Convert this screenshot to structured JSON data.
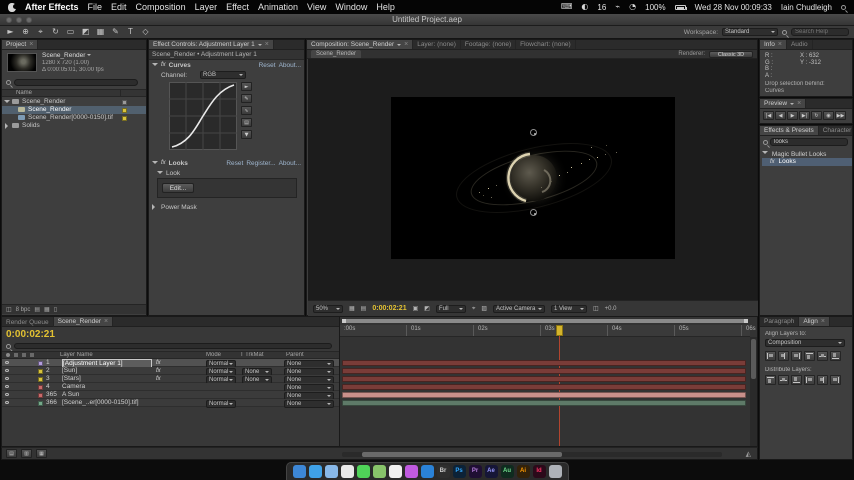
{
  "menubar": {
    "app_name": "After Effects",
    "menus": [
      "File",
      "Edit",
      "Composition",
      "Layer",
      "Effect",
      "Animation",
      "View",
      "Window",
      "Help"
    ],
    "status_count": "16",
    "battery_percent": "100%",
    "clock": "Wed 28 Nov 00:09:33",
    "user": "Iain Chudleigh"
  },
  "window": {
    "title": "Untitled Project.aep",
    "workspace_label": "Workspace:",
    "workspace_value": "Standard",
    "help_search": "Search Help"
  },
  "project": {
    "tab": "Project",
    "item_name": "Scene_Render",
    "item_meta1": "1280 x 720 (1.00)",
    "item_meta2": "Δ 0:00:05:01, 30.00 fps",
    "col_name": "Name",
    "depth": "8 bpc",
    "items": [
      {
        "label": "Scene_Render",
        "chip": "#9a9a9a"
      },
      {
        "label": "Scene_Render",
        "chip": "#d8c33c"
      },
      {
        "label": "Scene_Render[0000-0150].tif",
        "chip": "#d8c33c"
      },
      {
        "label": "Solids",
        "chip": "#9a9a9a"
      }
    ]
  },
  "effect_controls": {
    "tab": "Effect Controls: Adjustment Layer 1",
    "target": "Scene_Render • Adjustment Layer 1",
    "fx1_name": "Curves",
    "fx1_reset": "Reset",
    "fx1_about": "About...",
    "channel_label": "Channel:",
    "channel_value": "RGB",
    "fx2_name": "Looks",
    "fx2_reset": "Reset",
    "fx2_register": "Register...",
    "fx2_about": "About...",
    "look_label": "Look",
    "edit_button": "Edit...",
    "power_mask": "Power Mask"
  },
  "composition": {
    "tab": "Composition: Scene_Render",
    "tab_layer": "Layer: (none)",
    "tab_footage": "Footage: (none)",
    "tab_flowchart": "Flowchart: (none)",
    "view_tab": "Scene_Render",
    "renderer_label": "Renderer:",
    "renderer_value": "Classic 3D",
    "zoom": "50%",
    "timecode": "0:00:02:21",
    "resolution": "Full",
    "camera": "Active Camera",
    "views": "1 View",
    "exposure": "+0.0"
  },
  "info": {
    "tab": "Info",
    "tab_audio": "Audio",
    "r": "R :",
    "g": "G :",
    "b": "B :",
    "a": "A :",
    "x": "X :  632",
    "y": "Y : -312",
    "drop1": "Drop selection behind:",
    "drop2": "Curves"
  },
  "preview": {
    "tab": "Preview"
  },
  "effects_presets": {
    "tab": "Effects & Presets",
    "tab2": "Character",
    "search_value": "looks",
    "group": "Magic Bullet Looks",
    "item": "Looks"
  },
  "timeline": {
    "tab_queue": "Render Queue",
    "tab_comp": "Scene_Render",
    "timecode": "0:00:02:21",
    "col_layer": "Layer Name",
    "col_mode": "Mode",
    "col_trkmat": "T TrkMat",
    "col_parent": "Parent",
    "ruler": [
      ":00s",
      "01s",
      "02s",
      "03s",
      "04s",
      "05s",
      "06s"
    ],
    "layers": [
      {
        "num": "1",
        "name": "[Adjustment Layer 1]",
        "mode": "Normal",
        "trkmat": "",
        "parent": "None",
        "chip": "#b39ddb",
        "bar": "#7a3c38",
        "selected": true
      },
      {
        "num": "2",
        "name": "[Sun]",
        "mode": "Normal",
        "trkmat": "None",
        "parent": "None",
        "chip": "#d8c33c",
        "bar": "#7a3c38"
      },
      {
        "num": "3",
        "name": "[Stars]",
        "mode": "Normal",
        "trkmat": "None",
        "parent": "None",
        "chip": "#d8c33c",
        "bar": "#7a3c38"
      },
      {
        "num": "4",
        "name": "Camera",
        "mode": "",
        "trkmat": "",
        "parent": "None",
        "chip": "#c96a6a",
        "bar": "#7a3c38"
      },
      {
        "num": "365",
        "name": "A Sun",
        "mode": "",
        "trkmat": "",
        "parent": "None",
        "chip": "#c96a6a",
        "bar": "#c9908b"
      },
      {
        "num": "366",
        "name": "[Scene_..er[0000-0150].tif]",
        "mode": "Normal",
        "trkmat": "",
        "parent": "None",
        "chip": "#76a98a",
        "bar": "#5e7a68"
      }
    ]
  },
  "align": {
    "tab_paragraph": "Paragraph",
    "tab_align": "Align",
    "align_label": "Align Layers to:",
    "align_value": "Composition",
    "distribute_label": "Distribute Layers:"
  },
  "dock": {
    "apps": [
      {
        "name": "finder",
        "bg": "#3d87d6",
        "label": ""
      },
      {
        "name": "safari",
        "bg": "#3fa2e8",
        "label": ""
      },
      {
        "name": "mail",
        "bg": "#88b8e8",
        "label": ""
      },
      {
        "name": "photos",
        "bg": "#e8e8e8",
        "label": ""
      },
      {
        "name": "messages",
        "bg": "#4fd358",
        "label": ""
      },
      {
        "name": "maps",
        "bg": "#88c46a",
        "label": ""
      },
      {
        "name": "calendar",
        "bg": "#f0f0f0",
        "label": ""
      },
      {
        "name": "itunes",
        "bg": "#c05ae0",
        "label": ""
      },
      {
        "name": "app-store",
        "bg": "#2a82d8",
        "label": ""
      },
      {
        "name": "bridge",
        "bg": "#2e2e2e",
        "label": "Br",
        "fg": "#cfcfcf"
      },
      {
        "name": "photoshop",
        "bg": "#0c2237",
        "label": "Ps",
        "fg": "#31a8ff"
      },
      {
        "name": "premiere",
        "bg": "#1f0f33",
        "label": "Pr",
        "fg": "#b57edc"
      },
      {
        "name": "after-effects",
        "bg": "#161637",
        "label": "Ae",
        "fg": "#9999ff"
      },
      {
        "name": "audition",
        "bg": "#0f2b1f",
        "label": "Au",
        "fg": "#6fdc8c"
      },
      {
        "name": "illustrator",
        "bg": "#33220a",
        "label": "Ai",
        "fg": "#ff9a00"
      },
      {
        "name": "indesign",
        "bg": "#2b0a1a",
        "label": "Id",
        "fg": "#ff3366"
      },
      {
        "name": "trash",
        "bg": "#aeb2b8",
        "label": ""
      }
    ]
  }
}
